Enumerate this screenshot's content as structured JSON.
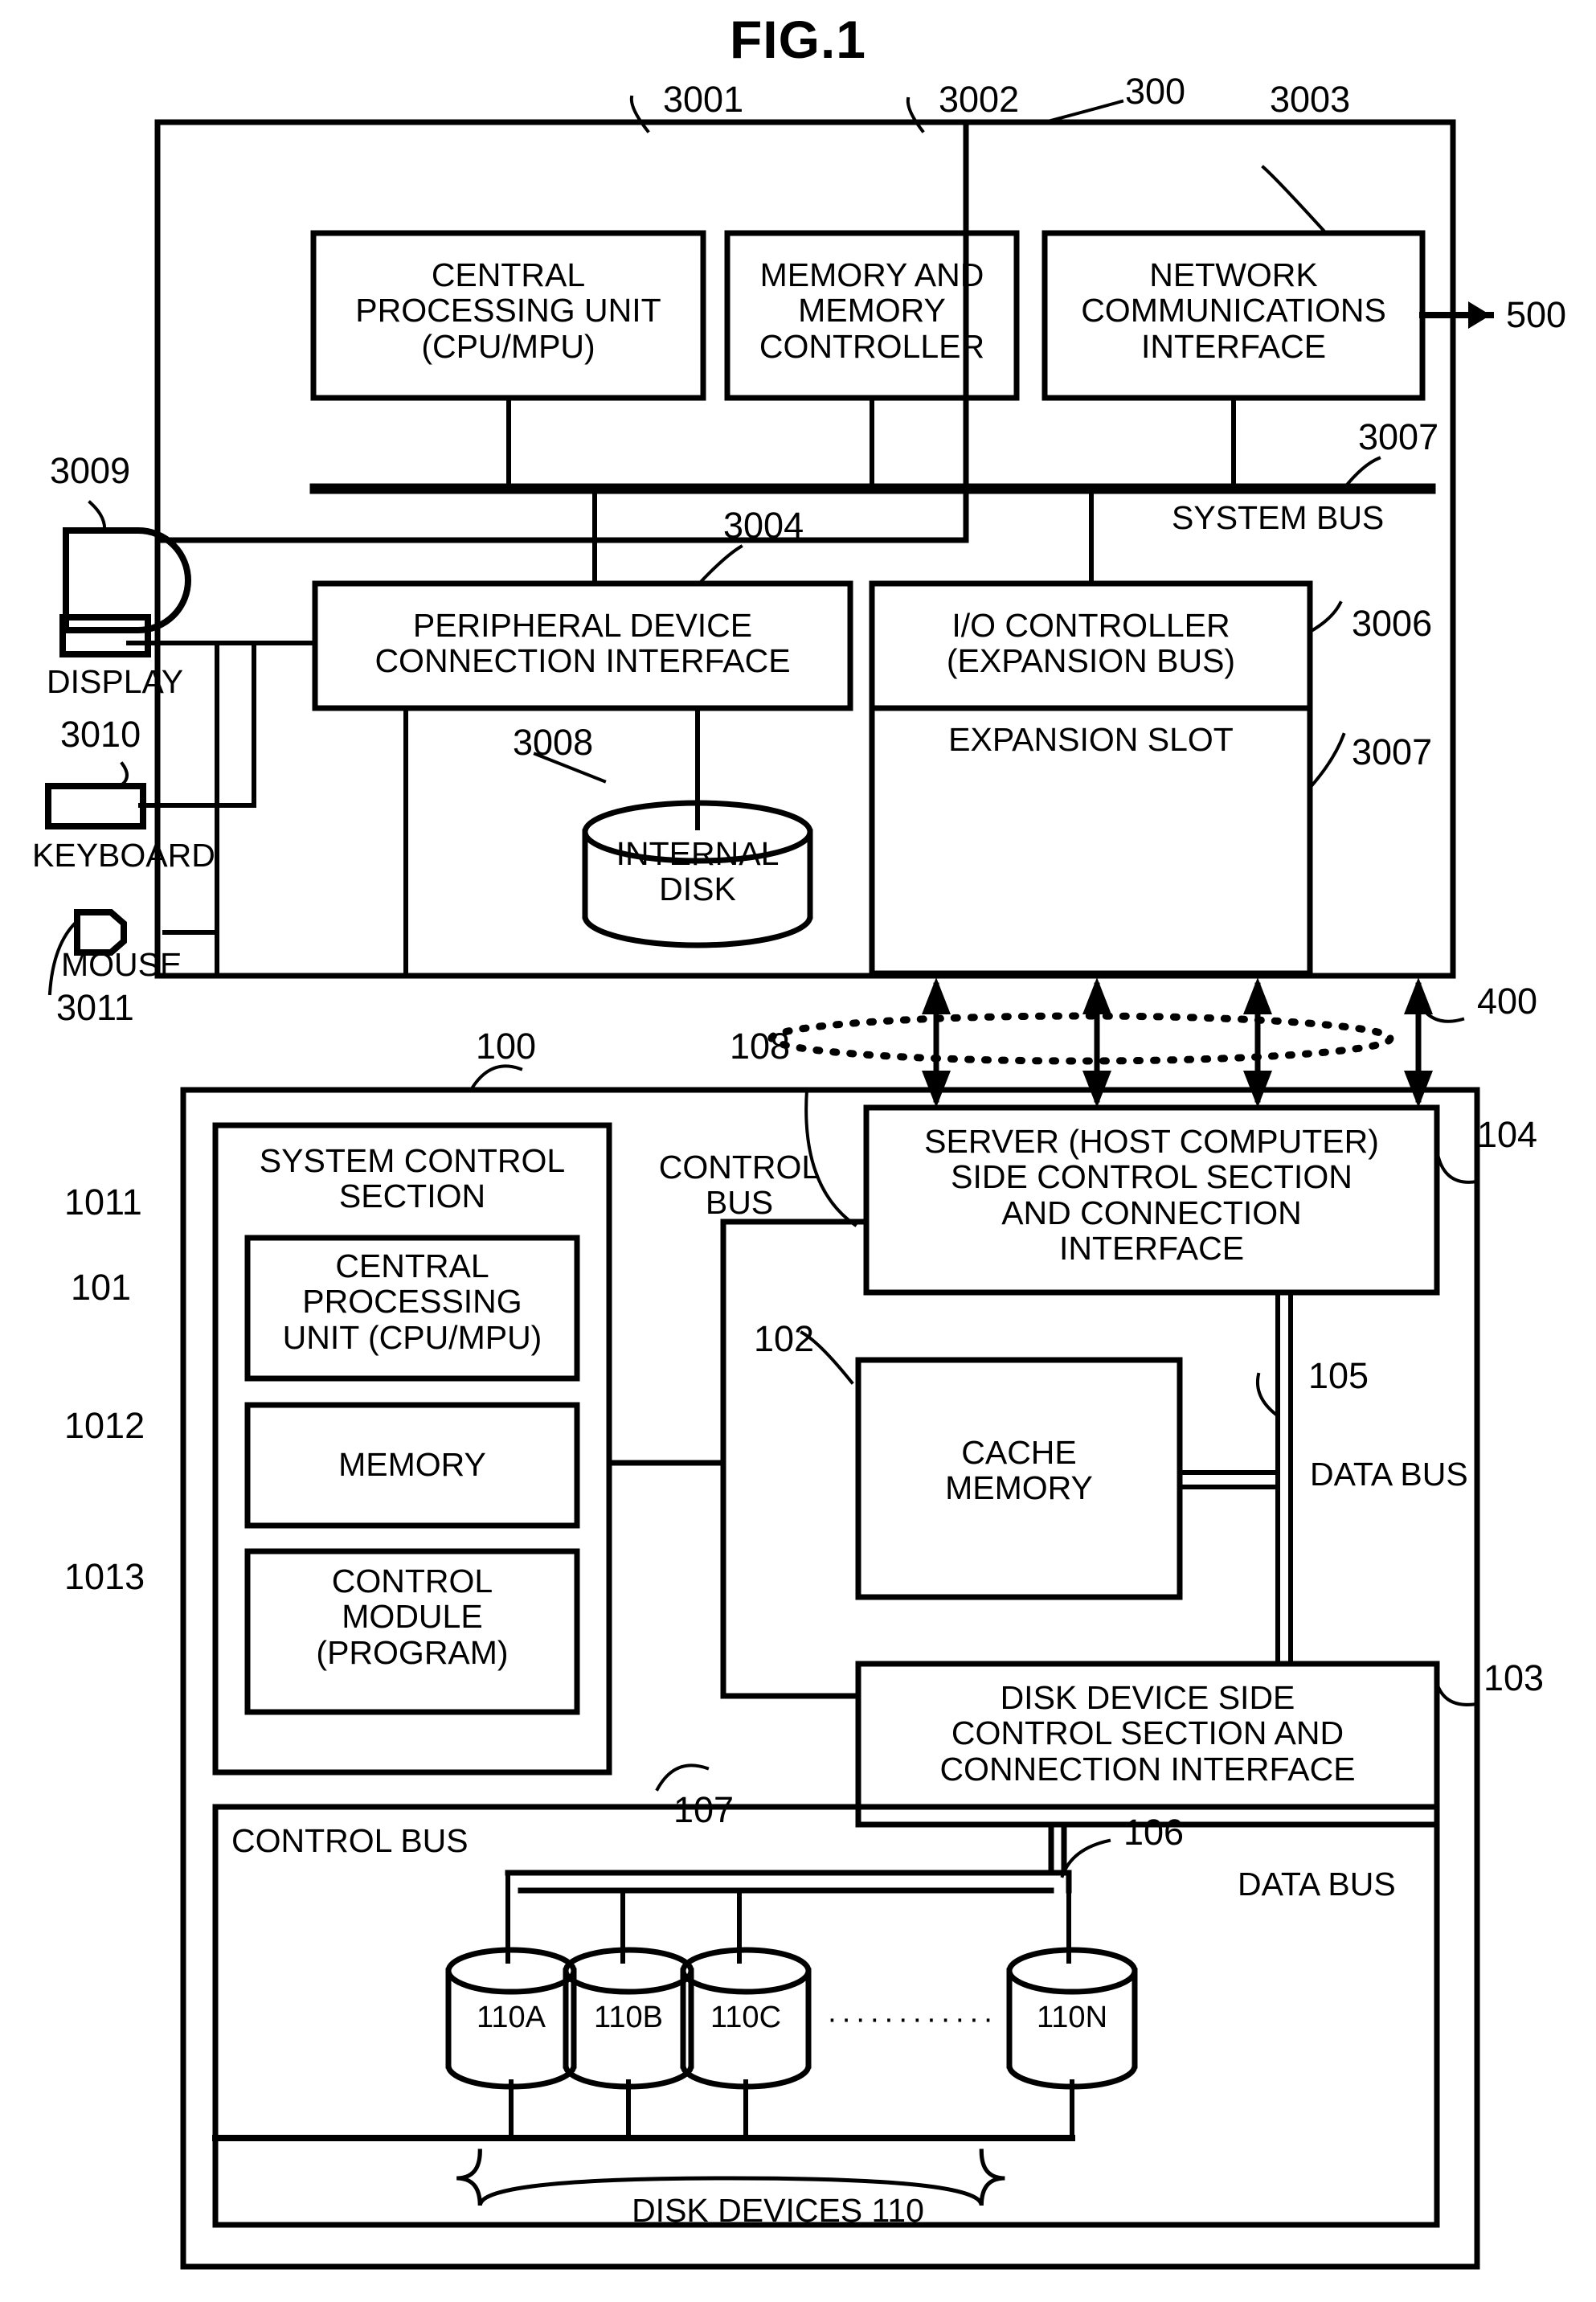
{
  "figure": {
    "title": "FIG.1"
  },
  "host": {
    "frame_ref": "300",
    "boxes": [
      {
        "ref": "3001",
        "label": "CENTRAL\nPROCESSING UNIT\n(CPU/MPU)"
      },
      {
        "ref": "3002",
        "label": "MEMORY AND\nMEMORY\nCONTROLLER"
      },
      {
        "ref": "3003",
        "label": "NETWORK\nCOMMUNICATIONS\nINTERFACE"
      }
    ],
    "network_ref": "500",
    "system_bus": {
      "ref": "3007",
      "label": "SYSTEM BUS"
    },
    "peripheral_interface": {
      "ref": "3004",
      "label": "PERIPHERAL DEVICE\nCONNECTION INTERFACE"
    },
    "io_controller": {
      "ref": "3006",
      "label": "I/O CONTROLLER\n(EXPANSION BUS)"
    },
    "expansion_slot": {
      "ref": "3007",
      "label": "EXPANSION SLOT"
    },
    "internal_disk": {
      "ref": "3008",
      "label": "INTERNAL\nDISK"
    },
    "peripherals": [
      {
        "ref": "3009",
        "label": "DISPLAY"
      },
      {
        "ref": "3010",
        "label": "KEYBOARD"
      },
      {
        "ref": "3011",
        "label": "MOUSE"
      }
    ]
  },
  "network": {
    "ref": "400"
  },
  "storage": {
    "frame_ref": "100",
    "system_control_section": {
      "ref": "101",
      "label": "SYSTEM CONTROL\nSECTION"
    },
    "cpu": {
      "ref": "1011",
      "label": "CENTRAL\nPROCESSING\nUNIT (CPU/MPU)"
    },
    "memory": {
      "ref": "1012",
      "label": "MEMORY"
    },
    "control_module": {
      "ref": "1013",
      "label": "CONTROL\nMODULE\n(PROGRAM)"
    },
    "control_bus_upper": {
      "ref": "108",
      "label": "CONTROL\nBUS"
    },
    "server_side_interface": {
      "ref": "104",
      "label": "SERVER (HOST COMPUTER)\nSIDE CONTROL SECTION\nAND CONNECTION\nINTERFACE"
    },
    "cache_memory": {
      "ref": "102",
      "label": "CACHE\nMEMORY"
    },
    "data_bus_upper": {
      "ref": "105",
      "label": "DATA BUS"
    },
    "disk_side_interface": {
      "ref": "103",
      "label": "DISK DEVICE SIDE\nCONTROL SECTION AND\nCONNECTION INTERFACE"
    },
    "control_bus_lower": {
      "ref": "107",
      "label": "CONTROL BUS"
    },
    "data_bus_lower": {
      "ref": "106",
      "label": "DATA BUS"
    },
    "disks": [
      {
        "label": "110A"
      },
      {
        "label": "110B"
      },
      {
        "label": "110C"
      },
      {
        "label": "110N"
      }
    ],
    "disk_ellipsis": "············",
    "disk_devices_label": "DISK DEVICES 110"
  },
  "colors": {
    "ink": "#000000",
    "paper": "#ffffff"
  }
}
